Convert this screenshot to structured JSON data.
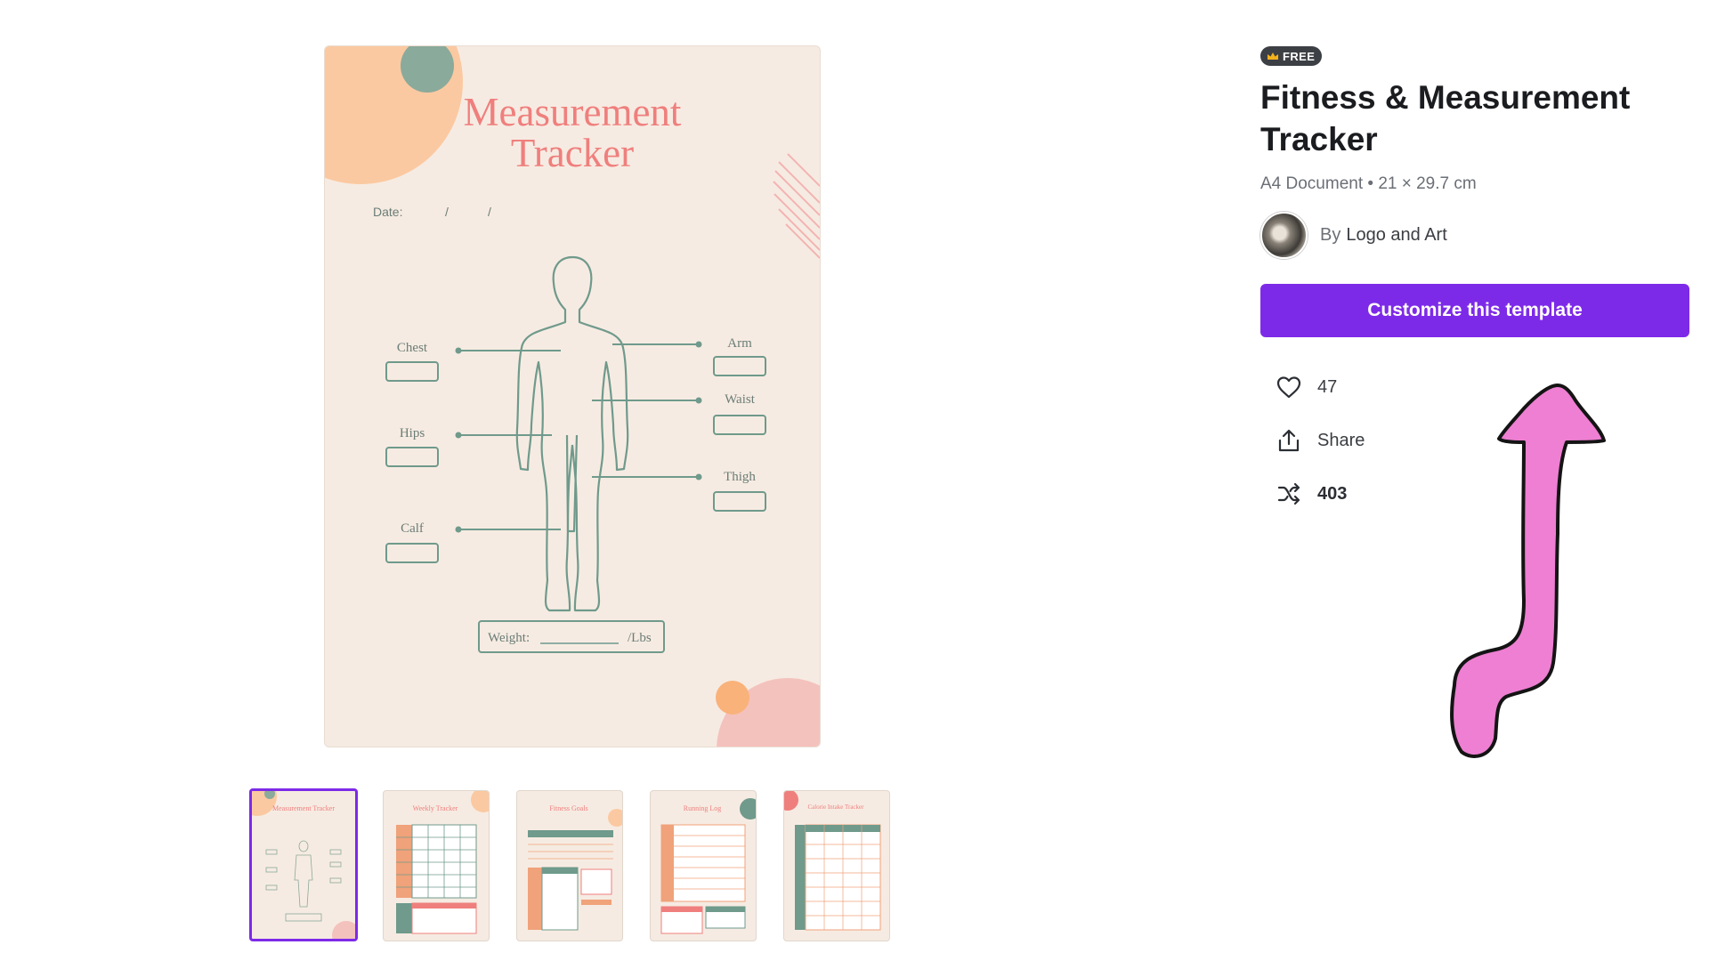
{
  "preview": {
    "title_line1": "Measurement",
    "title_line2": "Tracker",
    "date_label": "Date:",
    "date_sep1": "/",
    "date_sep2": "/",
    "labels": {
      "chest": "Chest",
      "hips": "Hips",
      "calf": "Calf",
      "arm": "Arm",
      "waist": "Waist",
      "thigh": "Thigh"
    },
    "weight_label": "Weight:",
    "weight_unit": "/Lbs"
  },
  "thumbnails": [
    {
      "title": "Measurement Tracker",
      "selected": true
    },
    {
      "title": "Weekly Tracker",
      "selected": false
    },
    {
      "title": "Fitness Goals",
      "selected": false
    },
    {
      "title": "Running Log",
      "selected": false
    },
    {
      "title": "Calorie Intake Tracker",
      "selected": false
    }
  ],
  "panel": {
    "badge": "FREE",
    "title": "Fitness & Measurement Tracker",
    "meta": "A4 Document • 21 × 29.7 cm",
    "author_by": "By",
    "author_name": "Logo and Art",
    "customize_label": "Customize this template",
    "actions": {
      "likes": "47",
      "share": "Share",
      "remixes": "403"
    }
  },
  "colors": {
    "accent": "#7d2ae8",
    "title_pink": "#ef7f7d",
    "outline_green": "#6f9a8c",
    "paper": "#f6ebe2",
    "annotation_pink": "#ee7fd2"
  },
  "icons": [
    "crown-icon",
    "heart-icon",
    "share-icon",
    "shuffle-icon"
  ]
}
